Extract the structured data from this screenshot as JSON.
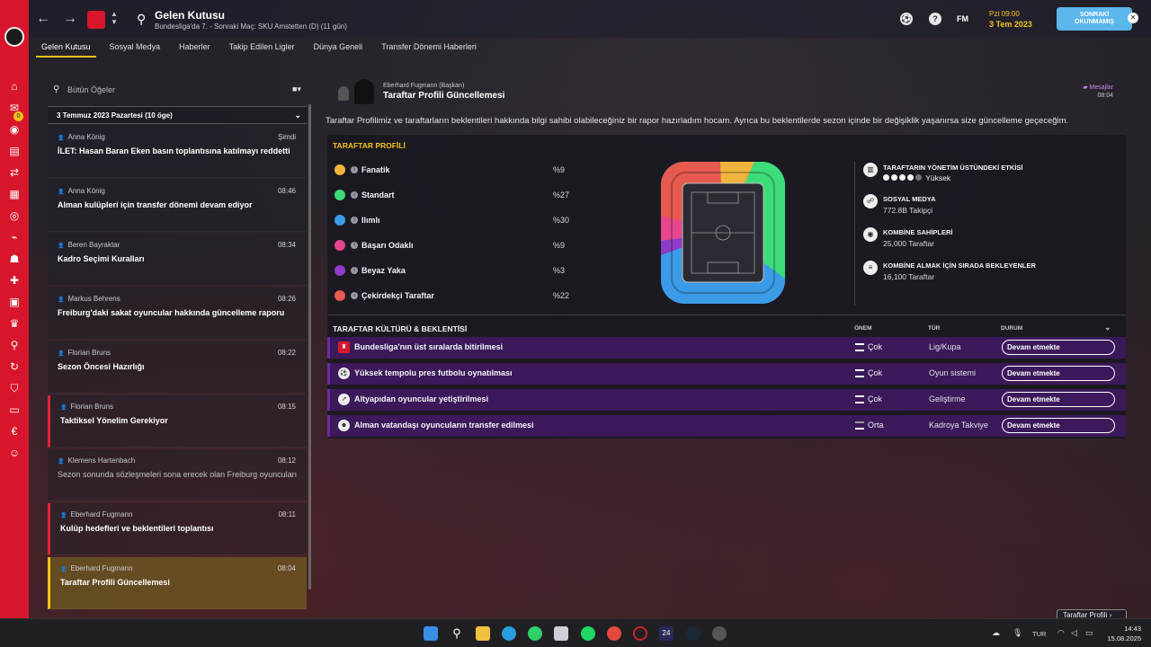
{
  "header": {
    "title": "Gelen Kutusu",
    "subtitle": "Bundesliga'da 7. - Sonraki Maç: SKU Amstetten (D) (11 gün)",
    "fm_label": "FM",
    "day_time": "Pzt 09:00",
    "date": "3 Tem 2023",
    "continue_line1": "SONRAKİ",
    "continue_line2": "OKUNMAMIŞ",
    "icon_help": "?"
  },
  "tabs": [
    {
      "label": "Gelen Kutusu"
    },
    {
      "label": "Sosyal Medya"
    },
    {
      "label": "Haberler"
    },
    {
      "label": "Takip Edilen Ligler"
    },
    {
      "label": "Dünya Geneli"
    },
    {
      "label": "Transfer Dönemi Haberleri"
    }
  ],
  "inbox": {
    "search_placeholder": "Bütün Öğeler",
    "group_header": "3 Temmuz 2023 Pazartesi (10 öge)",
    "unread_badge": "0",
    "messages": [
      {
        "sender": "Anna König",
        "time": "Şimdi",
        "subject": "İLET: Hasan Baran Eken basın toplantısına katılmayı reddetti"
      },
      {
        "sender": "Anna König",
        "time": "08:46",
        "subject": "Alman kulüpleri için transfer dönemi devam ediyor"
      },
      {
        "sender": "Beren Bayraktar",
        "time": "08:34",
        "subject": "Kadro Seçimi Kuralları"
      },
      {
        "sender": "Markus Behrens",
        "time": "08:26",
        "subject": "Freiburg'daki sakat oyuncular hakkında güncelleme raporu"
      },
      {
        "sender": "Florian Bruns",
        "time": "08:22",
        "subject": "Sezon Öncesi Hazırlığı"
      },
      {
        "sender": "Florian Bruns",
        "time": "08:15",
        "subject": "Taktiksel Yönelim Gerekiyor"
      },
      {
        "sender": "Klemens Hartenbach",
        "time": "08:12",
        "subject": "Sezon sonunda sözleşmeleri sona erecek olan Freiburg oyuncuları"
      },
      {
        "sender": "Eberhard Fugmann",
        "time": "08:11",
        "subject": "Kulüp hedefleri ve beklentileri toplantısı"
      },
      {
        "sender": "Eberhard Fugmann",
        "time": "08:04",
        "subject": "Taraftar Profili Güncellemesi"
      }
    ]
  },
  "message": {
    "from": "Eberhard Fugmann (Başkan)",
    "title": "Taraftar Profili Güncellemesi",
    "tag": "Mesajlar",
    "time": "08:04",
    "body": "Taraftar Profilimiz ve taraftarların beklentileri hakkında bilgi sahibi olabileceğiniz bir rapor hazırladım hocam. Ayrıca bu beklentilerde sezon içinde bir değişiklik yaşanırsa size güncelleme geçeceğim."
  },
  "fan_profile": {
    "title": "TARAFTAR PROFİLİ",
    "groups": [
      {
        "name": "Fanatik",
        "pct": "%9",
        "color": "#f0b43c"
      },
      {
        "name": "Standart",
        "pct": "%27",
        "color": "#3cdc78"
      },
      {
        "name": "Ilımlı",
        "pct": "%30",
        "color": "#3c9be6"
      },
      {
        "name": "Başarı Odaklı",
        "pct": "%9",
        "color": "#e6468c"
      },
      {
        "name": "Beyaz Yaka",
        "pct": "%3",
        "color": "#8c3cc8"
      },
      {
        "name": "Çekirdekçi Taraftar",
        "pct": "%22",
        "color": "#e65a50"
      }
    ],
    "stats": [
      {
        "label": "TARAFTARIN YÖNETİM ÜSTÜNDEKİ ETKİSİ",
        "value": "Yüksek",
        "rating": 4,
        "rating_max": 5
      },
      {
        "label": "SOSYAL MEDYA",
        "value": "772.8B Takipçi"
      },
      {
        "label": "KOMBİNE SAHİPLERİ",
        "value": "25,000 Taraftar"
      },
      {
        "label": "KOMBİNE ALMAK İÇİN SIRADA BEKLEYENLER",
        "value": "16,100 Taraftar"
      }
    ]
  },
  "expectations": {
    "title": "TARAFTAR KÜLTÜRÜ & BEKLENTİSİ",
    "col_importance": "ÖNEM",
    "col_type": "TÜR",
    "col_status": "DURUM",
    "rows": [
      {
        "text": "Bundesliga'nın üst sıralarda bitirilmesi",
        "importance": "Çok",
        "type": "Lig/Kupa",
        "status": "Devam etmekte"
      },
      {
        "text": "Yüksek tempolu pres futbolu oynatılması",
        "importance": "Çok",
        "type": "Oyun sistemi",
        "status": "Devam etmekte"
      },
      {
        "text": "Altyapıdan oyuncular yetiştirilmesi",
        "importance": "Çok",
        "type": "Geliştirme",
        "status": "Devam etmekte"
      },
      {
        "text": "Alman vatandaşı oyuncuların transfer edilmesi",
        "importance": "Orta",
        "type": "Kadroya Takviye",
        "status": "Devam etmekte"
      }
    ]
  },
  "footer": {
    "button": "Taraftar Profili"
  },
  "taskbar": {
    "lang": "TUR",
    "time": "14:43",
    "date": "15.08.2025"
  }
}
